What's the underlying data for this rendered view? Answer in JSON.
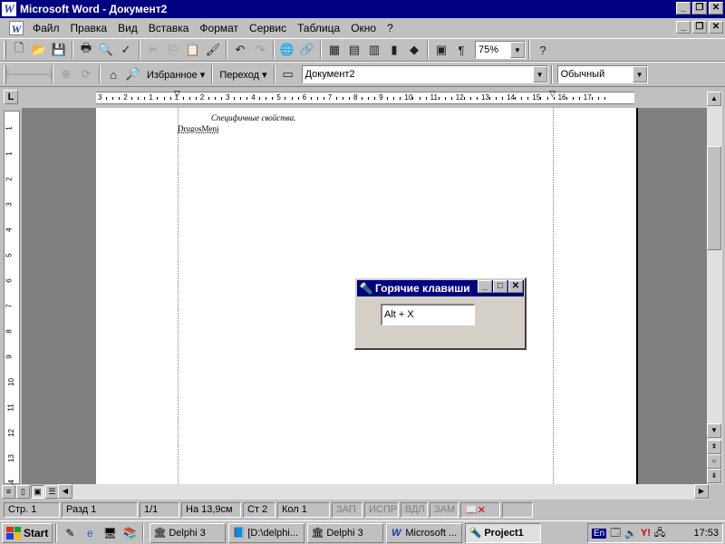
{
  "window": {
    "title": "Microsoft Word - Документ2",
    "app_icon": "W",
    "min": "_",
    "restore": "❐",
    "close": "✕"
  },
  "menu": {
    "items": [
      "Файл",
      "Правка",
      "Вид",
      "Вставка",
      "Формат",
      "Сервис",
      "Таблица",
      "Окно",
      "?"
    ]
  },
  "web_toolbar": {
    "favorites": "Избранное ▾",
    "goto": "Переход ▾",
    "address": "Документ2",
    "style": "Обычный"
  },
  "standard_toolbar": {
    "zoom": "75%"
  },
  "ruler": {
    "corner": "L",
    "numbers": [
      "3",
      "2",
      "1",
      "1",
      "2",
      "3",
      "4",
      "5",
      "6",
      "7",
      "8",
      "9",
      "10",
      "11",
      "12",
      "13",
      "14",
      "15",
      "16",
      "17"
    ],
    "v_numbers": [
      "1",
      "1",
      "2",
      "3",
      "4",
      "5",
      "6",
      "7",
      "8",
      "9",
      "10",
      "11",
      "12",
      "13",
      "14"
    ]
  },
  "document": {
    "line1": "Специфичные свойства.",
    "line2": "DrugosMeni"
  },
  "hotkeys_window": {
    "title": "Горячие клавиши",
    "field_value": "Alt + X"
  },
  "statusbar": {
    "page": "Стр.  1",
    "section": "Разд  1",
    "pages": "1/1",
    "at": "На  13,9см",
    "line": "Ст  2",
    "col": "Кол  1",
    "rec": "ЗАП",
    "trk": "ИСПР",
    "ext": "ВДЛ",
    "ovr": "ЗАМ"
  },
  "taskbar": {
    "start": "Start",
    "buttons": [
      "Delphi 3",
      "[D:\\delphi...",
      "Delphi 3",
      "Microsoft ...",
      "Project1"
    ],
    "active_index": 4,
    "lang": "En",
    "clock": "17:53"
  }
}
